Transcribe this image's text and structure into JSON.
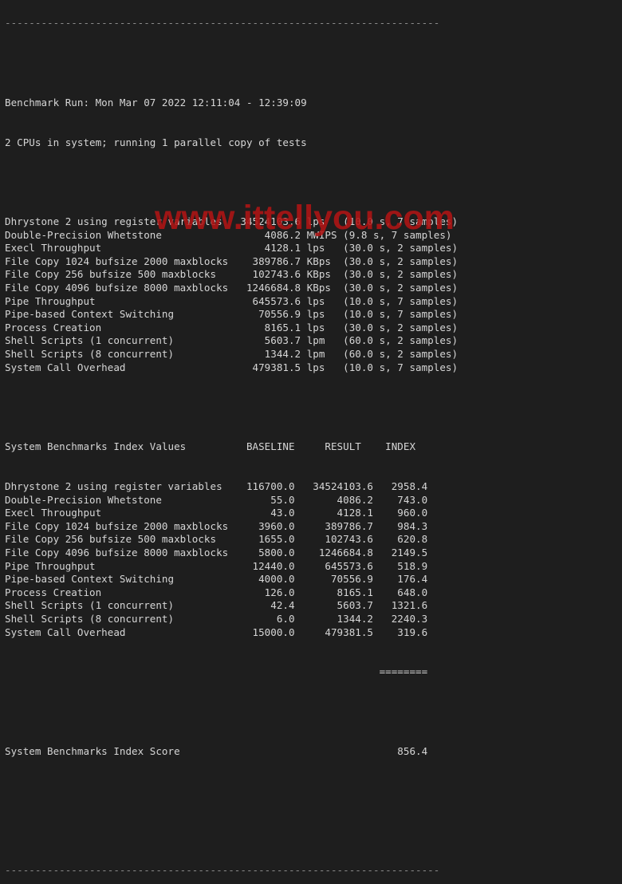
{
  "terminal": {
    "separator": "------------------------------------------------------------------------",
    "header": {
      "run_line": "Benchmark Run: Mon Mar 07 2022 12:11:04 - 12:39:09",
      "cpu_line": "2 CPUs in system; running 1 parallel copy of tests"
    },
    "results": [
      {
        "name": "Dhrystone 2 using register variables",
        "value": "34524103.6",
        "unit": "lps",
        "detail": "(10.0 s, 7 samples)"
      },
      {
        "name": "Double-Precision Whetstone",
        "value": "4086.2",
        "unit": "MWIPS",
        "detail": "(9.8 s, 7 samples)"
      },
      {
        "name": "Execl Throughput",
        "value": "4128.1",
        "unit": "lps",
        "detail": "(30.0 s, 2 samples)"
      },
      {
        "name": "File Copy 1024 bufsize 2000 maxblocks",
        "value": "389786.7",
        "unit": "KBps",
        "detail": "(30.0 s, 2 samples)"
      },
      {
        "name": "File Copy 256 bufsize 500 maxblocks",
        "value": "102743.6",
        "unit": "KBps",
        "detail": "(30.0 s, 2 samples)"
      },
      {
        "name": "File Copy 4096 bufsize 8000 maxblocks",
        "value": "1246684.8",
        "unit": "KBps",
        "detail": "(30.0 s, 2 samples)"
      },
      {
        "name": "Pipe Throughput",
        "value": "645573.6",
        "unit": "lps",
        "detail": "(10.0 s, 7 samples)"
      },
      {
        "name": "Pipe-based Context Switching",
        "value": "70556.9",
        "unit": "lps",
        "detail": "(10.0 s, 7 samples)"
      },
      {
        "name": "Process Creation",
        "value": "8165.1",
        "unit": "lps",
        "detail": "(30.0 s, 2 samples)"
      },
      {
        "name": "Shell Scripts (1 concurrent)",
        "value": "5603.7",
        "unit": "lpm",
        "detail": "(60.0 s, 2 samples)"
      },
      {
        "name": "Shell Scripts (8 concurrent)",
        "value": "1344.2",
        "unit": "lpm",
        "detail": "(60.0 s, 2 samples)"
      },
      {
        "name": "System Call Overhead",
        "value": "479381.5",
        "unit": "lps",
        "detail": "(10.0 s, 7 samples)"
      }
    ],
    "index_table": {
      "title": "System Benchmarks Index Values",
      "columns": [
        "BASELINE",
        "RESULT",
        "INDEX"
      ],
      "rows": [
        {
          "name": "Dhrystone 2 using register variables",
          "baseline": "116700.0",
          "result": "34524103.6",
          "index": "2958.4"
        },
        {
          "name": "Double-Precision Whetstone",
          "baseline": "55.0",
          "result": "4086.2",
          "index": "743.0"
        },
        {
          "name": "Execl Throughput",
          "baseline": "43.0",
          "result": "4128.1",
          "index": "960.0"
        },
        {
          "name": "File Copy 1024 bufsize 2000 maxblocks",
          "baseline": "3960.0",
          "result": "389786.7",
          "index": "984.3"
        },
        {
          "name": "File Copy 256 bufsize 500 maxblocks",
          "baseline": "1655.0",
          "result": "102743.6",
          "index": "620.8"
        },
        {
          "name": "File Copy 4096 bufsize 8000 maxblocks",
          "baseline": "5800.0",
          "result": "1246684.8",
          "index": "2149.5"
        },
        {
          "name": "Pipe Throughput",
          "baseline": "12440.0",
          "result": "645573.6",
          "index": "518.9"
        },
        {
          "name": "Pipe-based Context Switching",
          "baseline": "4000.0",
          "result": "70556.9",
          "index": "176.4"
        },
        {
          "name": "Process Creation",
          "baseline": "126.0",
          "result": "8165.1",
          "index": "648.0"
        },
        {
          "name": "Shell Scripts (1 concurrent)",
          "baseline": "42.4",
          "result": "5603.7",
          "index": "1321.6"
        },
        {
          "name": "Shell Scripts (8 concurrent)",
          "baseline": "6.0",
          "result": "1344.2",
          "index": "2240.3"
        },
        {
          "name": "System Call Overhead",
          "baseline": "15000.0",
          "result": "479381.5",
          "index": "319.6"
        }
      ],
      "divider": "========",
      "score_label": "System Benchmarks Index Score",
      "score": "856.4"
    }
  },
  "watermark": "www.ittellyou.com"
}
